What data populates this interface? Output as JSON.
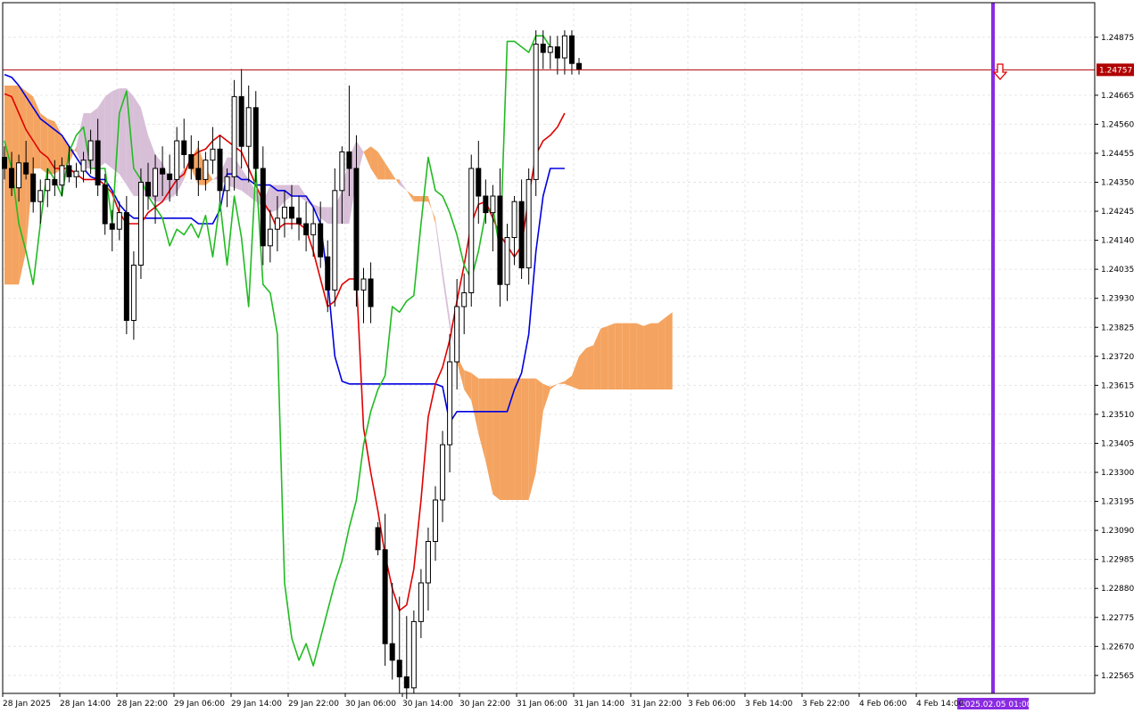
{
  "chart_data": {
    "type": "candlestick",
    "indicator": "Ichimoku Kinko Hyo",
    "grid": true,
    "ylim": [
      1.225,
      1.25
    ],
    "current_price": "1.24757",
    "time_marker_label": "2025.02.05 01:00",
    "y_ticks": [
      "1.24875",
      "1.24665",
      "1.24560",
      "1.24455",
      "1.24350",
      "1.24245",
      "1.24140",
      "1.24035",
      "1.23930",
      "1.23825",
      "1.23720",
      "1.23615",
      "1.23510",
      "1.23405",
      "1.23300",
      "1.23195",
      "1.23090",
      "1.22985",
      "1.22880",
      "1.22775",
      "1.22670",
      "1.22565"
    ],
    "x_ticks": [
      "28 Jan 2025",
      "28 Jan 14:00",
      "28 Jan 22:00",
      "29 Jan 06:00",
      "29 Jan 14:00",
      "29 Jan 22:00",
      "30 Jan 06:00",
      "30 Jan 14:00",
      "30 Jan 22:00",
      "31 Jan 06:00",
      "31 Jan 14:00",
      "31 Jan 22:00",
      "3 Feb 06:00",
      "3 Feb 14:00",
      "3 Feb 22:00",
      "4 Feb 06:00",
      "4 Feb 14:00"
    ],
    "colors": {
      "tenkan_sen": "#e00000",
      "kijun_sen": "#0000e0",
      "chikou_span": "#22bb22",
      "kumo_bullish": "#f4a460",
      "kumo_bearish": "#d8bfd8",
      "price_line": "#b00000",
      "time_marker": "#8a2be2",
      "signal_arrow": "#e00000"
    },
    "candles": [
      [
        1.2444,
        1.2448,
        1.2436,
        1.244
      ],
      [
        1.244,
        1.2446,
        1.243,
        1.2433
      ],
      [
        1.2433,
        1.2445,
        1.2428,
        1.2442
      ],
      [
        1.2442,
        1.245,
        1.2436,
        1.2438
      ],
      [
        1.2438,
        1.2444,
        1.2424,
        1.2428
      ],
      [
        1.2428,
        1.2436,
        1.242,
        1.2432
      ],
      [
        1.2432,
        1.244,
        1.2426,
        1.2436
      ],
      [
        1.2436,
        1.2443,
        1.243,
        1.2434
      ],
      [
        1.2434,
        1.2444,
        1.243,
        1.2441
      ],
      [
        1.2441,
        1.2448,
        1.2435,
        1.2437
      ],
      [
        1.2437,
        1.2442,
        1.2433,
        1.2439
      ],
      [
        1.2439,
        1.2446,
        1.2435,
        1.2443
      ],
      [
        1.2443,
        1.2454,
        1.2438,
        1.245
      ],
      [
        1.245,
        1.2458,
        1.243,
        1.2434
      ],
      [
        1.2434,
        1.2438,
        1.2416,
        1.242
      ],
      [
        1.242,
        1.2425,
        1.241,
        1.2418
      ],
      [
        1.2418,
        1.2428,
        1.2414,
        1.2424
      ],
      [
        1.2424,
        1.243,
        1.238,
        1.2385
      ],
      [
        1.2385,
        1.241,
        1.2378,
        1.2405
      ],
      [
        1.2405,
        1.244,
        1.24,
        1.2435
      ],
      [
        1.2435,
        1.2442,
        1.2425,
        1.243
      ],
      [
        1.243,
        1.2445,
        1.242,
        1.244
      ],
      [
        1.244,
        1.2448,
        1.243,
        1.2438
      ],
      [
        1.2438,
        1.2445,
        1.2428,
        1.2436
      ],
      [
        1.2436,
        1.2455,
        1.243,
        1.245
      ],
      [
        1.245,
        1.2458,
        1.244,
        1.2445
      ],
      [
        1.2445,
        1.2452,
        1.2436,
        1.244
      ],
      [
        1.244,
        1.245,
        1.243,
        1.2436
      ],
      [
        1.2436,
        1.2446,
        1.2432,
        1.2443
      ],
      [
        1.2443,
        1.2455,
        1.2438,
        1.2447
      ],
      [
        1.2447,
        1.2452,
        1.2428,
        1.2432
      ],
      [
        1.2432,
        1.244,
        1.2426,
        1.2437
      ],
      [
        1.2437,
        1.2472,
        1.2432,
        1.2466
      ],
      [
        1.2466,
        1.2476,
        1.244,
        1.2448
      ],
      [
        1.2448,
        1.247,
        1.2435,
        1.2462
      ],
      [
        1.2462,
        1.2468,
        1.2435,
        1.244
      ],
      [
        1.244,
        1.2448,
        1.2405,
        1.2412
      ],
      [
        1.2412,
        1.2425,
        1.2406,
        1.2418
      ],
      [
        1.2418,
        1.243,
        1.241,
        1.2422
      ],
      [
        1.2422,
        1.2432,
        1.2415,
        1.2426
      ],
      [
        1.2426,
        1.2434,
        1.2418,
        1.2422
      ],
      [
        1.2422,
        1.243,
        1.2414,
        1.242
      ],
      [
        1.242,
        1.2428,
        1.241,
        1.2416
      ],
      [
        1.2416,
        1.2426,
        1.2408,
        1.242
      ],
      [
        1.242,
        1.2428,
        1.2404,
        1.2408
      ],
      [
        1.2408,
        1.2414,
        1.2388,
        1.2396
      ],
      [
        1.2396,
        1.244,
        1.239,
        1.2432
      ],
      [
        1.2432,
        1.2448,
        1.242,
        1.2446
      ],
      [
        1.2446,
        1.247,
        1.243,
        1.244
      ],
      [
        1.244,
        1.2452,
        1.239,
        1.2396
      ],
      [
        1.2396,
        1.2404,
        1.2384,
        1.24
      ],
      [
        1.24,
        1.2406,
        1.2384,
        1.239
      ],
      [
        1.231,
        1.2312,
        1.23,
        1.2302
      ],
      [
        1.2302,
        1.2315,
        1.226,
        1.2268
      ],
      [
        1.2268,
        1.229,
        1.2255,
        1.2262
      ],
      [
        1.2262,
        1.2285,
        1.225,
        1.2256
      ],
      [
        1.2256,
        1.2278,
        1.2248,
        1.2252
      ],
      [
        1.2252,
        1.228,
        1.225,
        1.2276
      ],
      [
        1.2276,
        1.2295,
        1.227,
        1.229
      ],
      [
        1.229,
        1.231,
        1.228,
        1.2305
      ],
      [
        1.2305,
        1.2325,
        1.2298,
        1.232
      ],
      [
        1.232,
        1.2345,
        1.2312,
        1.234
      ],
      [
        1.234,
        1.238,
        1.233,
        1.237
      ],
      [
        1.237,
        1.24,
        1.236,
        1.239
      ],
      [
        1.239,
        1.2402,
        1.238,
        1.2395
      ],
      [
        1.2395,
        1.2445,
        1.239,
        1.244
      ],
      [
        1.244,
        1.245,
        1.242,
        1.243
      ],
      [
        1.243,
        1.2436,
        1.242,
        1.2424
      ],
      [
        1.2424,
        1.2434,
        1.241,
        1.243
      ],
      [
        1.243,
        1.244,
        1.239,
        1.2398
      ],
      [
        1.2398,
        1.242,
        1.2392,
        1.2415
      ],
      [
        1.2415,
        1.243,
        1.2405,
        1.2428
      ],
      [
        1.2428,
        1.2436,
        1.24,
        1.2404
      ],
      [
        1.2404,
        1.244,
        1.2398,
        1.2436
      ],
      [
        1.2436,
        1.249,
        1.243,
        1.2485
      ],
      [
        1.2485,
        1.249,
        1.2476,
        1.2482
      ],
      [
        1.2482,
        1.2488,
        1.2476,
        1.2484
      ],
      [
        1.2484,
        1.2488,
        1.2474,
        1.248
      ],
      [
        1.248,
        1.249,
        1.2474,
        1.2488
      ],
      [
        1.2488,
        1.249,
        1.2474,
        1.2478
      ],
      [
        1.2478,
        1.248,
        1.2474,
        1.2476
      ]
    ],
    "tenkan_sen": [
      1.2467,
      1.2466,
      1.246,
      1.2454,
      1.245,
      1.2446,
      1.2444,
      1.244,
      1.244,
      1.244,
      1.2438,
      1.2436,
      1.2436,
      1.2436,
      1.2434,
      1.2431,
      1.2424,
      1.242,
      1.242,
      1.242,
      1.2424,
      1.2426,
      1.2428,
      1.2432,
      1.2436,
      1.2438,
      1.2444,
      1.2446,
      1.2447,
      1.245,
      1.2452,
      1.245,
      1.2448,
      1.2446,
      1.244,
      1.2434,
      1.2428,
      1.2424,
      1.2418,
      1.242,
      1.242,
      1.242,
      1.2418,
      1.241,
      1.24,
      1.239,
      1.2392,
      1.2398,
      1.24,
      1.24,
      1.2346,
      1.233,
      1.2316,
      1.23,
      1.2288,
      1.228,
      1.2282,
      1.2295,
      1.232,
      1.235,
      1.2362,
      1.2368,
      1.2378,
      1.2392,
      1.2405,
      1.242,
      1.2427,
      1.2428,
      1.2422,
      1.2416,
      1.2412,
      1.2408,
      1.2412,
      1.243,
      1.2445,
      1.245,
      1.2452,
      1.2455,
      1.246
    ],
    "kijun_sen": [
      1.2474,
      1.2473,
      1.247,
      1.2466,
      1.2462,
      1.2458,
      1.2456,
      1.2454,
      1.2452,
      1.2448,
      1.2444,
      1.244,
      1.2437,
      1.2436,
      1.2436,
      1.2432,
      1.2427,
      1.2424,
      1.2422,
      1.2422,
      1.2422,
      1.2422,
      1.2422,
      1.2422,
      1.2422,
      1.2422,
      1.2422,
      1.242,
      1.242,
      1.242,
      1.2425,
      1.2438,
      1.2438,
      1.2436,
      1.2436,
      1.2434,
      1.2434,
      1.2434,
      1.2432,
      1.2432,
      1.243,
      1.243,
      1.243,
      1.2426,
      1.242,
      1.24,
      1.2372,
      1.2363,
      1.2362,
      1.2362,
      1.2362,
      1.2362,
      1.2362,
      1.2362,
      1.2362,
      1.2362,
      1.2362,
      1.2362,
      1.2362,
      1.2362,
      1.2362,
      1.2361,
      1.2348,
      1.2352,
      1.2352,
      1.2352,
      1.2352,
      1.2352,
      1.2352,
      1.2352,
      1.2352,
      1.236,
      1.2366,
      1.238,
      1.241,
      1.243,
      1.244,
      1.244,
      1.244
    ],
    "chikou_span": [
      1.245,
      1.244,
      1.242,
      1.241,
      1.2398,
      1.242,
      1.244,
      1.2436,
      1.243,
      1.2446,
      1.2452,
      1.2455,
      1.244,
      1.244,
      1.244,
      1.242,
      1.246,
      1.2468,
      1.244,
      1.2436,
      1.243,
      1.2426,
      1.2422,
      1.2412,
      1.2418,
      1.2416,
      1.242,
      1.2415,
      1.2423,
      1.2408,
      1.2428,
      1.2405,
      1.243,
      1.2415,
      1.239,
      1.244,
      1.2398,
      1.2395,
      1.238,
      1.229,
      1.227,
      1.2262,
      1.2268,
      1.226,
      1.227,
      1.228,
      1.229,
      1.2298,
      1.231,
      1.232,
      1.234,
      1.2352,
      1.236,
      1.2365,
      1.239,
      1.2388,
      1.2392,
      1.2394,
      1.242,
      1.2444,
      1.2432,
      1.243,
      1.2424,
      1.2416,
      1.2405,
      1.24,
      1.241,
      1.2424,
      1.2426,
      1.241,
      1.2486,
      1.2486,
      1.2484,
      1.2482,
      1.2488,
      1.2488,
      1.2484
    ],
    "kumo_a": [
      1.247,
      1.247,
      1.247,
      1.2468,
      1.2466,
      1.246,
      1.2458,
      1.2457,
      1.2452,
      1.2448,
      1.2446,
      1.244,
      1.244,
      1.244,
      1.2442,
      1.244,
      1.2438,
      1.2434,
      1.243,
      1.243,
      1.243,
      1.2428,
      1.2428,
      1.2429,
      1.2431,
      1.2436,
      1.2444,
      1.2448,
      1.244,
      1.2436,
      1.2436,
      1.2434,
      1.2433,
      1.2432,
      1.243,
      1.2428,
      1.2426,
      1.2424,
      1.2425,
      1.2428,
      1.243,
      1.243,
      1.2428,
      1.2426,
      1.2422,
      1.242,
      1.242,
      1.242,
      1.242,
      1.2436,
      1.2446,
      1.2448,
      1.2446,
      1.2442,
      1.2438,
      1.2434,
      1.2432,
      1.243,
      1.243,
      1.243,
      1.242,
      1.24,
      1.2382,
      1.2372,
      1.2367,
      1.2366,
      1.2364,
      1.2364,
      1.2364,
      1.2364,
      1.2364,
      1.2364,
      1.2364,
      1.2364,
      1.2364,
      1.2362,
      1.2361,
      1.2362,
      1.2363,
      1.2365,
      1.2372,
      1.2375,
      1.2376,
      1.2382,
      1.2383,
      1.2384,
      1.2384,
      1.2384,
      1.2384,
      1.2383,
      1.2384,
      1.2384,
      1.2386,
      1.2388
    ],
    "kumo_b": [
      1.2398,
      1.2398,
      1.2398,
      1.241,
      1.244,
      1.244,
      1.2438,
      1.2438,
      1.244,
      1.2442,
      1.2448,
      1.246,
      1.246,
      1.2462,
      1.2466,
      1.2468,
      1.2469,
      1.2469,
      1.2466,
      1.2462,
      1.2452,
      1.2445,
      1.2442,
      1.2436,
      1.2436,
      1.244,
      1.244,
      1.2434,
      1.2434,
      1.2436,
      1.2438,
      1.2444,
      1.2444,
      1.244,
      1.2436,
      1.2432,
      1.2428,
      1.2434,
      1.2434,
      1.2434,
      1.2434,
      1.2434,
      1.243,
      1.2427,
      1.2426,
      1.2426,
      1.2426,
      1.2432,
      1.2444,
      1.245,
      1.2446,
      1.244,
      1.2436,
      1.2436,
      1.2436,
      1.2436,
      1.2432,
      1.2428,
      1.2428,
      1.2428,
      1.2422,
      1.2404,
      1.2386,
      1.237,
      1.236,
      1.2356,
      1.2344,
      1.2334,
      1.2322,
      1.232,
      1.232,
      1.232,
      1.232,
      1.232,
      1.233,
      1.2352,
      1.236,
      1.2362,
      1.2362,
      1.2361,
      1.236,
      1.236,
      1.236,
      1.236,
      1.236,
      1.236,
      1.236,
      1.236,
      1.236,
      1.236,
      1.236,
      1.236,
      1.236,
      1.236
    ]
  }
}
